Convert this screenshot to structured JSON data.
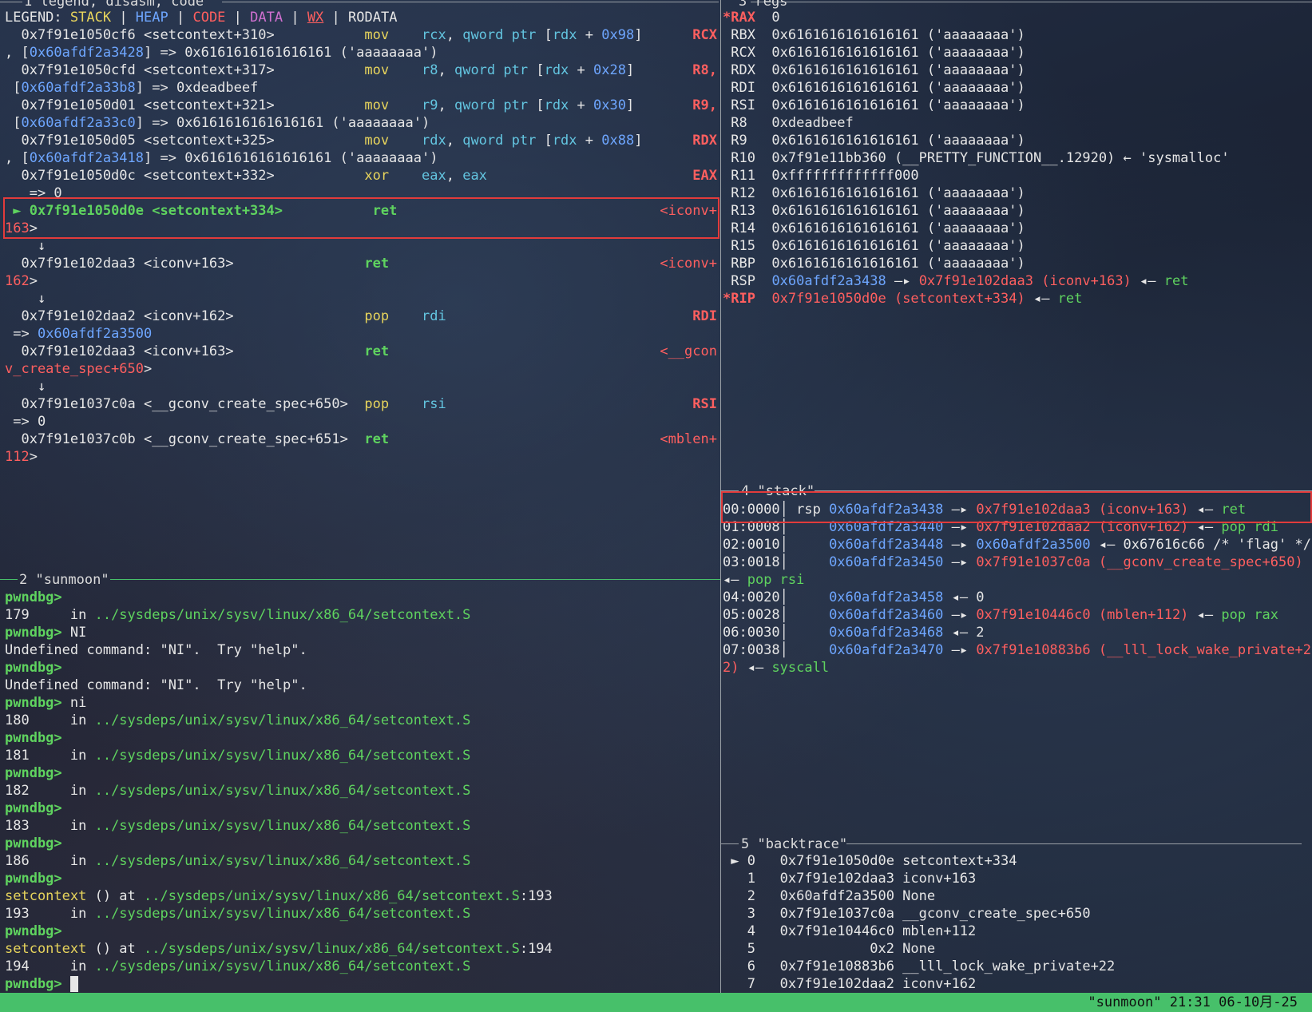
{
  "window": {
    "status": "\"sunmoon\" 21:31 06-10月-25"
  },
  "pane1": {
    "title": "1 legend, disasm, code",
    "legend": {
      "prefix": "LEGEND: ",
      "stack": "STACK",
      "heap": "HEAP",
      "code": "CODE",
      "data": "DATA",
      "wx": "WX",
      "rodata": "RODATA",
      "sep": " | "
    },
    "lines": [
      [
        [
          "  0x7f91e1050cf6 <setcontext+310>           ",
          "white"
        ],
        [
          "mov    ",
          "yellow"
        ],
        [
          "rcx",
          "cyan"
        ],
        [
          ", ",
          "white"
        ],
        [
          "qword ptr ",
          "cyan"
        ],
        [
          "[",
          "white"
        ],
        [
          "rdx",
          "cyan"
        ],
        [
          " + ",
          "white"
        ],
        [
          "0x98",
          "blue"
        ],
        [
          "]",
          "white"
        ]
      ],
      [
        [
          ", [",
          "white"
        ],
        [
          "0x60afdf2a3428",
          "blue"
        ],
        [
          "] => 0x6161616161616161 ('aaaaaaaa')",
          "white"
        ]
      ],
      [
        [
          "  0x7f91e1050cfd <setcontext+317>           ",
          "white"
        ],
        [
          "mov    ",
          "yellow"
        ],
        [
          "r8",
          "cyan"
        ],
        [
          ", ",
          "white"
        ],
        [
          "qword ptr ",
          "cyan"
        ],
        [
          "[",
          "white"
        ],
        [
          "rdx",
          "cyan"
        ],
        [
          " + ",
          "white"
        ],
        [
          "0x28",
          "blue"
        ],
        [
          "]",
          "white"
        ]
      ],
      [
        [
          " [",
          "white"
        ],
        [
          "0x60afdf2a33b8",
          "blue"
        ],
        [
          "] => 0xdeadbeef",
          "white"
        ]
      ],
      [
        [
          "  0x7f91e1050d01 <setcontext+321>           ",
          "white"
        ],
        [
          "mov    ",
          "yellow"
        ],
        [
          "r9",
          "cyan"
        ],
        [
          ", ",
          "white"
        ],
        [
          "qword ptr ",
          "cyan"
        ],
        [
          "[",
          "white"
        ],
        [
          "rdx",
          "cyan"
        ],
        [
          " + ",
          "white"
        ],
        [
          "0x30",
          "blue"
        ],
        [
          "]",
          "white"
        ]
      ],
      [
        [
          " [",
          "white"
        ],
        [
          "0x60afdf2a33c0",
          "blue"
        ],
        [
          "] => 0x6161616161616161 ('aaaaaaaa')",
          "white"
        ]
      ],
      [
        [
          "  0x7f91e1050d05 <setcontext+325>           ",
          "white"
        ],
        [
          "mov    ",
          "yellow"
        ],
        [
          "rdx",
          "cyan"
        ],
        [
          ", ",
          "white"
        ],
        [
          "qword ptr ",
          "cyan"
        ],
        [
          "[",
          "white"
        ],
        [
          "rdx",
          "cyan"
        ],
        [
          " + ",
          "white"
        ],
        [
          "0x88",
          "blue"
        ],
        [
          "]",
          "white"
        ]
      ],
      [
        [
          ", [",
          "white"
        ],
        [
          "0x60afdf2a3418",
          "blue"
        ],
        [
          "] => 0x6161616161616161 ('aaaaaaaa')",
          "white"
        ]
      ],
      [
        [
          "  0x7f91e1050d0c <setcontext+332>           ",
          "white"
        ],
        [
          "xor    ",
          "yellow"
        ],
        [
          "eax",
          "cyan"
        ],
        [
          ", ",
          "white"
        ],
        [
          "eax",
          "cyan"
        ]
      ],
      [
        [
          "   => 0",
          "white"
        ]
      ],
      [
        [
          " ► ",
          "bgreen"
        ],
        [
          "0x7f91e1050d0e <setcontext+334>",
          "bgreen"
        ],
        [
          "           ",
          "white"
        ],
        [
          "ret",
          "bgreen"
        ]
      ],
      [
        [
          "163",
          "red"
        ],
        [
          ">",
          "white"
        ]
      ],
      [
        [
          "    ↓",
          "white"
        ]
      ],
      [
        [
          "  0x7f91e102daa3 <iconv+163>                ",
          "white"
        ],
        [
          "ret",
          "bgreen"
        ]
      ],
      [
        [
          "162",
          "red"
        ],
        [
          ">",
          "white"
        ]
      ],
      [
        [
          "    ↓",
          "white"
        ]
      ],
      [
        [
          "  0x7f91e102daa2 <iconv+162>                ",
          "white"
        ],
        [
          "pop    ",
          "yellow"
        ],
        [
          "rdi",
          "cyan"
        ]
      ],
      [
        [
          " => ",
          "white"
        ],
        [
          "0x60afdf2a3500",
          "blue"
        ]
      ],
      [
        [
          "  0x7f91e102daa3 <iconv+163>                ",
          "white"
        ],
        [
          "ret",
          "bgreen"
        ]
      ],
      [
        [
          "v_create_spec+650",
          "red"
        ],
        [
          ">",
          "white"
        ]
      ],
      [
        [
          "    ↓",
          "white"
        ]
      ],
      [
        [
          "  0x7f91e1037c0a <__gconv_create_spec+650>  ",
          "white"
        ],
        [
          "pop    ",
          "yellow"
        ],
        [
          "rsi",
          "cyan"
        ]
      ],
      [
        [
          " => 0",
          "white"
        ]
      ],
      [
        [
          "  0x7f91e1037c0b <__gconv_create_spec+651>  ",
          "white"
        ],
        [
          "ret",
          "bgreen"
        ]
      ],
      [
        [
          "112",
          "red"
        ],
        [
          ">",
          "white"
        ]
      ]
    ],
    "right_labels": [
      {
        "line": 0,
        "text": "RCX",
        "c": "bred"
      },
      {
        "line": 2,
        "text": "R8,",
        "c": "bred"
      },
      {
        "line": 4,
        "text": "R9,",
        "c": "bred"
      },
      {
        "line": 6,
        "text": "RDX",
        "c": "bred"
      },
      {
        "line": 8,
        "text": "EAX",
        "c": "bred"
      },
      {
        "line": 10,
        "text": "<iconv+",
        "c": "red"
      },
      {
        "line": 13,
        "text": "<iconv+",
        "c": "red"
      },
      {
        "line": 16,
        "text": "RDI",
        "c": "bred"
      },
      {
        "line": 18,
        "text": "<__gcon",
        "c": "red"
      },
      {
        "line": 21,
        "text": "RSI",
        "c": "bred"
      },
      {
        "line": 23,
        "text": "<mblen+",
        "c": "red"
      }
    ]
  },
  "pane2": {
    "title": "2 \"sunmoon\"",
    "lines": [
      [
        [
          "pwndbg>",
          "bgreen"
        ]
      ],
      [
        [
          "179     in ",
          "white"
        ],
        [
          "../sysdeps/unix/sysv/linux/x86_64/setcontext.S",
          "green"
        ]
      ],
      [
        [
          "pwndbg>",
          "bgreen"
        ],
        [
          " NI",
          "white"
        ]
      ],
      [
        [
          "Undefined command: \"NI\".  Try \"help\".",
          "white"
        ]
      ],
      [
        [
          "pwndbg>",
          "bgreen"
        ]
      ],
      [
        [
          "Undefined command: \"NI\".  Try \"help\".",
          "white"
        ]
      ],
      [
        [
          "pwndbg>",
          "bgreen"
        ],
        [
          " ni",
          "white"
        ]
      ],
      [
        [
          "180     in ",
          "white"
        ],
        [
          "../sysdeps/unix/sysv/linux/x86_64/setcontext.S",
          "green"
        ]
      ],
      [
        [
          "pwndbg>",
          "bgreen"
        ]
      ],
      [
        [
          "181     in ",
          "white"
        ],
        [
          "../sysdeps/unix/sysv/linux/x86_64/setcontext.S",
          "green"
        ]
      ],
      [
        [
          "pwndbg>",
          "bgreen"
        ]
      ],
      [
        [
          "182     in ",
          "white"
        ],
        [
          "../sysdeps/unix/sysv/linux/x86_64/setcontext.S",
          "green"
        ]
      ],
      [
        [
          "pwndbg>",
          "bgreen"
        ]
      ],
      [
        [
          "183     in ",
          "white"
        ],
        [
          "../sysdeps/unix/sysv/linux/x86_64/setcontext.S",
          "green"
        ]
      ],
      [
        [
          "pwndbg>",
          "bgreen"
        ]
      ],
      [
        [
          "186     in ",
          "white"
        ],
        [
          "../sysdeps/unix/sysv/linux/x86_64/setcontext.S",
          "green"
        ]
      ],
      [
        [
          "pwndbg>",
          "bgreen"
        ]
      ],
      [
        [
          "setcontext",
          "yellow"
        ],
        [
          " () at ",
          "white"
        ],
        [
          "../sysdeps/unix/sysv/linux/x86_64/setcontext.S",
          "green"
        ],
        [
          ":193",
          "white"
        ]
      ],
      [
        [
          "193     in ",
          "white"
        ],
        [
          "../sysdeps/unix/sysv/linux/x86_64/setcontext.S",
          "green"
        ]
      ],
      [
        [
          "pwndbg>",
          "bgreen"
        ]
      ],
      [
        [
          "setcontext",
          "yellow"
        ],
        [
          " () at ",
          "white"
        ],
        [
          "../sysdeps/unix/sysv/linux/x86_64/setcontext.S",
          "green"
        ],
        [
          ":194",
          "white"
        ]
      ],
      [
        [
          "194     in ",
          "white"
        ],
        [
          "../sysdeps/unix/sysv/linux/x86_64/setcontext.S",
          "green"
        ]
      ]
    ],
    "prompt": "pwndbg>"
  },
  "pane3": {
    "title": "3 regs",
    "lines": [
      [
        [
          "*RAX ",
          "bred"
        ],
        [
          " 0",
          "white"
        ]
      ],
      [
        [
          " RBX ",
          "white"
        ],
        [
          " 0x6161616161616161 ('aaaaaaaa')",
          "white"
        ]
      ],
      [
        [
          " RCX ",
          "white"
        ],
        [
          " 0x6161616161616161 ('aaaaaaaa')",
          "white"
        ]
      ],
      [
        [
          " RDX ",
          "white"
        ],
        [
          " 0x6161616161616161 ('aaaaaaaa')",
          "white"
        ]
      ],
      [
        [
          " RDI ",
          "white"
        ],
        [
          " 0x6161616161616161 ('aaaaaaaa')",
          "white"
        ]
      ],
      [
        [
          " RSI ",
          "white"
        ],
        [
          " 0x6161616161616161 ('aaaaaaaa')",
          "white"
        ]
      ],
      [
        [
          " R8  ",
          "white"
        ],
        [
          " 0xdeadbeef",
          "white"
        ]
      ],
      [
        [
          " R9  ",
          "white"
        ],
        [
          " 0x6161616161616161 ('aaaaaaaa')",
          "white"
        ]
      ],
      [
        [
          " R10 ",
          "white"
        ],
        [
          " 0x7f91e11bb360 (__PRETTY_FUNCTION__.12920) ← 'sysmalloc'",
          "white"
        ]
      ],
      [
        [
          " R11 ",
          "white"
        ],
        [
          " 0xfffffffffffff000",
          "white"
        ]
      ],
      [
        [
          " R12 ",
          "white"
        ],
        [
          " 0x6161616161616161 ('aaaaaaaa')",
          "white"
        ]
      ],
      [
        [
          " R13 ",
          "white"
        ],
        [
          " 0x6161616161616161 ('aaaaaaaa')",
          "white"
        ]
      ],
      [
        [
          " R14 ",
          "white"
        ],
        [
          " 0x6161616161616161 ('aaaaaaaa')",
          "white"
        ]
      ],
      [
        [
          " R15 ",
          "white"
        ],
        [
          " 0x6161616161616161 ('aaaaaaaa')",
          "white"
        ]
      ],
      [
        [
          " RBP ",
          "white"
        ],
        [
          " 0x6161616161616161 ('aaaaaaaa')",
          "white"
        ]
      ],
      [
        [
          " RSP ",
          "white"
        ],
        [
          " ",
          "white"
        ],
        [
          "0x60afdf2a3438",
          "blue"
        ],
        [
          " —▸ ",
          "white"
        ],
        [
          "0x7f91e102daa3 (iconv+163)",
          "red"
        ],
        [
          " ◂— ",
          "white"
        ],
        [
          "ret",
          "green"
        ]
      ],
      [
        [
          "*RIP ",
          "bred"
        ],
        [
          " ",
          "white"
        ],
        [
          "0x7f91e1050d0e (setcontext+334)",
          "red"
        ],
        [
          " ◂— ",
          "white"
        ],
        [
          "ret",
          "green"
        ]
      ]
    ]
  },
  "pane4": {
    "title": "4 \"stack\"",
    "lines": [
      [
        [
          "00:0000│ ",
          "white"
        ],
        [
          "rsp ",
          "white"
        ],
        [
          "0x60afdf2a3438",
          "blue"
        ],
        [
          " —▸ ",
          "white"
        ],
        [
          "0x7f91e102daa3 (iconv+163)",
          "red"
        ],
        [
          " ◂— ",
          "white"
        ],
        [
          "ret",
          "green"
        ]
      ],
      [
        [
          "01:0008│     ",
          "white"
        ],
        [
          "0x60afdf2a3440",
          "blue"
        ],
        [
          " —▸ ",
          "white"
        ],
        [
          "0x7f91e102daa2 (iconv+162)",
          "red"
        ],
        [
          " ◂— ",
          "white"
        ],
        [
          "pop rdi",
          "green"
        ]
      ],
      [
        [
          "02:0010│     ",
          "white"
        ],
        [
          "0x60afdf2a3448",
          "blue"
        ],
        [
          " —▸ ",
          "white"
        ],
        [
          "0x60afdf2a3500",
          "blue"
        ],
        [
          " ◂— 0x67616c66 /* 'flag' */",
          "white"
        ]
      ],
      [
        [
          "03:0018│     ",
          "white"
        ],
        [
          "0x60afdf2a3450",
          "blue"
        ],
        [
          " —▸ ",
          "white"
        ],
        [
          "0x7f91e1037c0a (__gconv_create_spec+650)",
          "red"
        ]
      ],
      [
        [
          "◂— ",
          "white"
        ],
        [
          "pop rsi",
          "green"
        ]
      ],
      [
        [
          "04:0020│     ",
          "white"
        ],
        [
          "0x60afdf2a3458",
          "blue"
        ],
        [
          " ◂— 0",
          "white"
        ]
      ],
      [
        [
          "05:0028│     ",
          "white"
        ],
        [
          "0x60afdf2a3460",
          "blue"
        ],
        [
          " —▸ ",
          "white"
        ],
        [
          "0x7f91e10446c0 (mblen+112)",
          "red"
        ],
        [
          " ◂— ",
          "white"
        ],
        [
          "pop rax",
          "green"
        ]
      ],
      [
        [
          "06:0030│     ",
          "white"
        ],
        [
          "0x60afdf2a3468",
          "blue"
        ],
        [
          " ◂— 2",
          "white"
        ]
      ],
      [
        [
          "07:0038│     ",
          "white"
        ],
        [
          "0x60afdf2a3470",
          "blue"
        ],
        [
          " —▸ ",
          "white"
        ],
        [
          "0x7f91e10883b6 (__lll_lock_wake_private+2",
          "red"
        ]
      ],
      [
        [
          "2)",
          "red"
        ],
        [
          " ◂— ",
          "white"
        ],
        [
          "syscall",
          "green"
        ]
      ]
    ]
  },
  "pane5": {
    "title": "5 \"backtrace\"",
    "lines": [
      [
        [
          " ► 0   0x7f91e1050d0e setcontext+334",
          "white"
        ]
      ],
      [
        [
          "   1   0x7f91e102daa3 iconv+163",
          "white"
        ]
      ],
      [
        [
          "   2   0x60afdf2a3500 None",
          "white"
        ]
      ],
      [
        [
          "   3   0x7f91e1037c0a __gconv_create_spec+650",
          "white"
        ]
      ],
      [
        [
          "   4   0x7f91e10446c0 mblen+112",
          "white"
        ]
      ],
      [
        [
          "   5              0x2 None",
          "white"
        ]
      ],
      [
        [
          "   6   0x7f91e10883b6 __lll_lock_wake_private+22",
          "white"
        ]
      ],
      [
        [
          "   7   0x7f91e102daa2 iconv+162",
          "white"
        ]
      ]
    ]
  }
}
